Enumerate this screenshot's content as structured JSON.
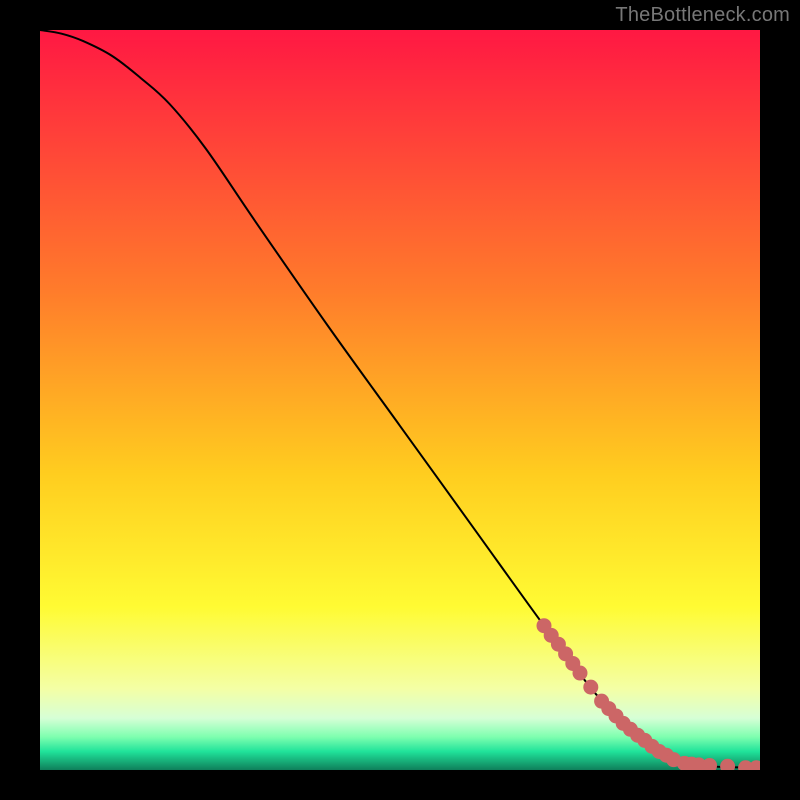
{
  "watermark": "TheBottleneck.com",
  "chart_data": {
    "type": "line",
    "title": "",
    "xlabel": "",
    "ylabel": "",
    "xlim": [
      0,
      100
    ],
    "ylim": [
      0,
      100
    ],
    "background": {
      "style": "vertical-gradient",
      "stops": [
        {
          "offset": 0,
          "color": "#ff1843"
        },
        {
          "offset": 0.35,
          "color": "#ff7b2b"
        },
        {
          "offset": 0.6,
          "color": "#ffcd1f"
        },
        {
          "offset": 0.78,
          "color": "#fffb33"
        },
        {
          "offset": 0.89,
          "color": "#f4ffa5"
        },
        {
          "offset": 0.93,
          "color": "#d6ffd6"
        },
        {
          "offset": 0.955,
          "color": "#7fffb0"
        },
        {
          "offset": 0.975,
          "color": "#20e39a"
        },
        {
          "offset": 1.0,
          "color": "#0f7f5a"
        }
      ]
    },
    "series": [
      {
        "name": "curve",
        "x": [
          0,
          3,
          6,
          10,
          14,
          18,
          23,
          30,
          40,
          50,
          60,
          70,
          77,
          82,
          86,
          88,
          90,
          92,
          95,
          100
        ],
        "y": [
          100,
          99.5,
          98.5,
          96.5,
          93.5,
          90,
          84,
          74,
          60,
          46.5,
          33,
          19.5,
          10.5,
          5.5,
          2.5,
          1.4,
          0.9,
          0.6,
          0.4,
          0.3
        ]
      }
    ],
    "markers": {
      "name": "highlight-points",
      "color": "#cc6666",
      "points": [
        {
          "x": 70.0,
          "y": 19.5
        },
        {
          "x": 71.0,
          "y": 18.2
        },
        {
          "x": 72.0,
          "y": 17.0
        },
        {
          "x": 73.0,
          "y": 15.7
        },
        {
          "x": 74.0,
          "y": 14.4
        },
        {
          "x": 75.0,
          "y": 13.1
        },
        {
          "x": 76.5,
          "y": 11.2
        },
        {
          "x": 78.0,
          "y": 9.3
        },
        {
          "x": 79.0,
          "y": 8.3
        },
        {
          "x": 80.0,
          "y": 7.3
        },
        {
          "x": 81.0,
          "y": 6.3
        },
        {
          "x": 82.0,
          "y": 5.5
        },
        {
          "x": 83.0,
          "y": 4.7
        },
        {
          "x": 84.0,
          "y": 4.0
        },
        {
          "x": 85.0,
          "y": 3.2
        },
        {
          "x": 86.0,
          "y": 2.5
        },
        {
          "x": 87.0,
          "y": 2.0
        },
        {
          "x": 88.0,
          "y": 1.4
        },
        {
          "x": 89.5,
          "y": 0.9
        },
        {
          "x": 90.5,
          "y": 0.8
        },
        {
          "x": 91.5,
          "y": 0.7
        },
        {
          "x": 93.0,
          "y": 0.6
        },
        {
          "x": 95.5,
          "y": 0.5
        },
        {
          "x": 98.0,
          "y": 0.3
        },
        {
          "x": 99.5,
          "y": 0.3
        }
      ]
    }
  }
}
